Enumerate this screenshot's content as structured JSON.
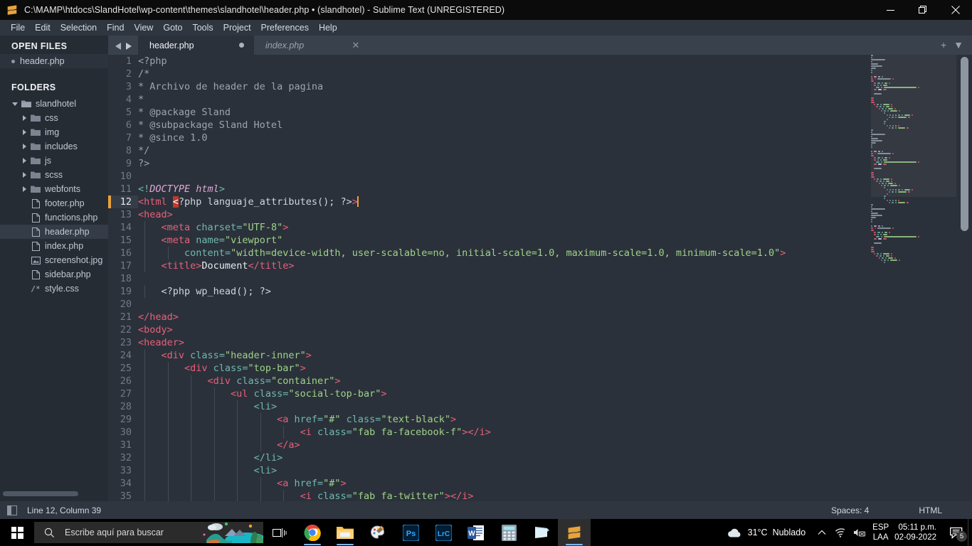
{
  "window": {
    "title": "C:\\MAMP\\htdocs\\SlandHotel\\wp-content\\themes\\slandhotel\\header.php • (slandhotel) - Sublime Text (UNREGISTERED)",
    "app_icon": "sublime-text-icon",
    "controls": {
      "minimize": "minimize-icon",
      "restore": "restore-icon",
      "close": "close-icon"
    }
  },
  "menubar": {
    "items": [
      {
        "label": "File"
      },
      {
        "label": "Edit"
      },
      {
        "label": "Selection"
      },
      {
        "label": "Find"
      },
      {
        "label": "View"
      },
      {
        "label": "Goto"
      },
      {
        "label": "Tools"
      },
      {
        "label": "Project"
      },
      {
        "label": "Preferences"
      },
      {
        "label": "Help"
      }
    ]
  },
  "sidebar": {
    "open_files_header": "OPEN FILES",
    "open_files": [
      {
        "label": "header.php",
        "modified": true
      }
    ],
    "folders_header": "FOLDERS",
    "tree": [
      {
        "label": "slandhotel",
        "kind": "folder-open",
        "depth": 0,
        "expanded": true,
        "selected": false
      },
      {
        "label": "css",
        "kind": "folder",
        "depth": 1,
        "expanded": false,
        "selected": false
      },
      {
        "label": "img",
        "kind": "folder",
        "depth": 1,
        "expanded": false,
        "selected": false
      },
      {
        "label": "includes",
        "kind": "folder",
        "depth": 1,
        "expanded": false,
        "selected": false
      },
      {
        "label": "js",
        "kind": "folder",
        "depth": 1,
        "expanded": false,
        "selected": false
      },
      {
        "label": "scss",
        "kind": "folder",
        "depth": 1,
        "expanded": false,
        "selected": false
      },
      {
        "label": "webfonts",
        "kind": "folder",
        "depth": 1,
        "expanded": false,
        "selected": false
      },
      {
        "label": "footer.php",
        "kind": "file",
        "depth": 1,
        "selected": false
      },
      {
        "label": "functions.php",
        "kind": "file",
        "depth": 1,
        "selected": false
      },
      {
        "label": "header.php",
        "kind": "file",
        "depth": 1,
        "selected": true
      },
      {
        "label": "index.php",
        "kind": "file",
        "depth": 1,
        "selected": false
      },
      {
        "label": "screenshot.jpg",
        "kind": "image",
        "depth": 1,
        "selected": false
      },
      {
        "label": "sidebar.php",
        "kind": "file",
        "depth": 1,
        "selected": false
      },
      {
        "label": "style.css",
        "kind": "css",
        "depth": 1,
        "selected": false
      }
    ]
  },
  "tabs": {
    "nav_prev": "chevron-left-icon",
    "nav_next": "chevron-right-icon",
    "items": [
      {
        "label": "header.php",
        "active": true,
        "modified": true,
        "preview": false
      },
      {
        "label": "index.php",
        "active": false,
        "modified": false,
        "preview": true
      }
    ],
    "new_tab": "+",
    "tab_menu": "▼"
  },
  "editor": {
    "first_line": 1,
    "cursor_line": 12,
    "lines": [
      {
        "n": 1,
        "tokens": [
          {
            "t": "<?php",
            "c": "c-comment"
          }
        ]
      },
      {
        "n": 2,
        "tokens": [
          {
            "t": "/*",
            "c": "c-comment"
          }
        ]
      },
      {
        "n": 3,
        "tokens": [
          {
            "t": "* Archivo de header de la pagina",
            "c": "c-comment"
          }
        ]
      },
      {
        "n": 4,
        "tokens": [
          {
            "t": "*",
            "c": "c-comment"
          }
        ]
      },
      {
        "n": 5,
        "tokens": [
          {
            "t": "* @package Sland",
            "c": "c-comment"
          }
        ]
      },
      {
        "n": 6,
        "tokens": [
          {
            "t": "* @subpackage Sland Hotel",
            "c": "c-comment"
          }
        ]
      },
      {
        "n": 7,
        "tokens": [
          {
            "t": "* @since 1.0",
            "c": "c-comment"
          }
        ]
      },
      {
        "n": 8,
        "tokens": [
          {
            "t": "*/",
            "c": "c-comment"
          }
        ]
      },
      {
        "n": 9,
        "tokens": [
          {
            "t": "?>",
            "c": "c-comment"
          }
        ]
      },
      {
        "n": 10,
        "tokens": []
      },
      {
        "n": 11,
        "tokens": [
          {
            "t": "<!",
            "c": "c-punct"
          },
          {
            "t": "DOCTYPE",
            "c": "c-doctype-name"
          },
          {
            "t": " html",
            "c": "c-doctype-name"
          },
          {
            "t": ">",
            "c": "c-punct"
          }
        ]
      },
      {
        "n": 12,
        "tokens": [
          {
            "t": "<html",
            "c": "c-tag"
          },
          {
            "t": " ",
            "c": "c-php"
          },
          {
            "t": "<",
            "c": "c-err"
          },
          {
            "t": "?php languaje_attributes(); ?>",
            "c": "c-php"
          },
          {
            "t": ">",
            "c": "c-tag"
          },
          {
            "t": "",
            "c": "caret"
          }
        ]
      },
      {
        "n": 13,
        "tokens": [
          {
            "t": "<head>",
            "c": "c-tag"
          }
        ]
      },
      {
        "n": 14,
        "tokens": [
          {
            "t": "    ",
            "c": "c-php"
          },
          {
            "t": "<meta",
            "c": "c-tag"
          },
          {
            "t": " charset",
            "c": "c-punct"
          },
          {
            "t": "=",
            "c": "c-punct"
          },
          {
            "t": "\"UTF-8\"",
            "c": "c-str"
          },
          {
            "t": ">",
            "c": "c-tag"
          }
        ]
      },
      {
        "n": 15,
        "tokens": [
          {
            "t": "    ",
            "c": "c-php"
          },
          {
            "t": "<meta",
            "c": "c-tag"
          },
          {
            "t": " name",
            "c": "c-punct"
          },
          {
            "t": "=",
            "c": "c-punct"
          },
          {
            "t": "\"viewport\"",
            "c": "c-str"
          }
        ]
      },
      {
        "n": 16,
        "tokens": [
          {
            "t": "        ",
            "c": "c-php"
          },
          {
            "t": "content",
            "c": "c-punct"
          },
          {
            "t": "=",
            "c": "c-punct"
          },
          {
            "t": "\"width=device-width, user-scalable=no, initial-scale=1.0, maximum-scale=1.0, minimum-scale=1.0\"",
            "c": "c-str"
          },
          {
            "t": ">",
            "c": "c-tag"
          }
        ]
      },
      {
        "n": 17,
        "tokens": [
          {
            "t": "    ",
            "c": "c-php"
          },
          {
            "t": "<title>",
            "c": "c-tag"
          },
          {
            "t": "Document",
            "c": "c-text"
          },
          {
            "t": "</title>",
            "c": "c-tag"
          }
        ]
      },
      {
        "n": 18,
        "tokens": []
      },
      {
        "n": 19,
        "tokens": [
          {
            "t": "    <?php wp_head(); ?>",
            "c": "c-php"
          }
        ]
      },
      {
        "n": 20,
        "tokens": []
      },
      {
        "n": 21,
        "tokens": [
          {
            "t": "</head>",
            "c": "c-tag"
          }
        ]
      },
      {
        "n": 22,
        "tokens": [
          {
            "t": "<body>",
            "c": "c-tag"
          }
        ]
      },
      {
        "n": 23,
        "tokens": [
          {
            "t": "<header>",
            "c": "c-tag"
          }
        ]
      },
      {
        "n": 24,
        "tokens": [
          {
            "t": "    ",
            "c": "c-php"
          },
          {
            "t": "<div",
            "c": "c-tag"
          },
          {
            "t": " class",
            "c": "c-punct"
          },
          {
            "t": "=",
            "c": "c-punct"
          },
          {
            "t": "\"header-inner\"",
            "c": "c-str"
          },
          {
            "t": ">",
            "c": "c-tag"
          }
        ]
      },
      {
        "n": 25,
        "tokens": [
          {
            "t": "        ",
            "c": "c-php"
          },
          {
            "t": "<div",
            "c": "c-tag"
          },
          {
            "t": " class",
            "c": "c-punct"
          },
          {
            "t": "=",
            "c": "c-punct"
          },
          {
            "t": "\"top-bar\"",
            "c": "c-str"
          },
          {
            "t": ">",
            "c": "c-tag"
          }
        ]
      },
      {
        "n": 26,
        "tokens": [
          {
            "t": "            ",
            "c": "c-php"
          },
          {
            "t": "<div",
            "c": "c-tag"
          },
          {
            "t": " class",
            "c": "c-punct"
          },
          {
            "t": "=",
            "c": "c-punct"
          },
          {
            "t": "\"container\"",
            "c": "c-str"
          },
          {
            "t": ">",
            "c": "c-tag"
          }
        ]
      },
      {
        "n": 27,
        "tokens": [
          {
            "t": "                ",
            "c": "c-php"
          },
          {
            "t": "<ul",
            "c": "c-tag"
          },
          {
            "t": " class",
            "c": "c-punct"
          },
          {
            "t": "=",
            "c": "c-punct"
          },
          {
            "t": "\"social-top-bar\"",
            "c": "c-str"
          },
          {
            "t": ">",
            "c": "c-tag"
          }
        ]
      },
      {
        "n": 28,
        "tokens": [
          {
            "t": "                    ",
            "c": "c-php"
          },
          {
            "t": "<li>",
            "c": "c-punct"
          }
        ]
      },
      {
        "n": 29,
        "tokens": [
          {
            "t": "                        ",
            "c": "c-php"
          },
          {
            "t": "<a",
            "c": "c-entity"
          },
          {
            "t": " href",
            "c": "c-punct"
          },
          {
            "t": "=",
            "c": "c-punct"
          },
          {
            "t": "\"#\"",
            "c": "c-str"
          },
          {
            "t": " class",
            "c": "c-punct"
          },
          {
            "t": "=",
            "c": "c-punct"
          },
          {
            "t": "\"text-black\"",
            "c": "c-str"
          },
          {
            "t": ">",
            "c": "c-tag"
          }
        ]
      },
      {
        "n": 30,
        "tokens": [
          {
            "t": "                            ",
            "c": "c-php"
          },
          {
            "t": "<i",
            "c": "c-entity"
          },
          {
            "t": " class",
            "c": "c-punct"
          },
          {
            "t": "=",
            "c": "c-punct"
          },
          {
            "t": "\"fab fa-facebook-f\"",
            "c": "c-str"
          },
          {
            "t": "></i>",
            "c": "c-entity"
          }
        ]
      },
      {
        "n": 31,
        "tokens": [
          {
            "t": "                        ",
            "c": "c-php"
          },
          {
            "t": "</a>",
            "c": "c-entity"
          }
        ]
      },
      {
        "n": 32,
        "tokens": [
          {
            "t": "                    ",
            "c": "c-php"
          },
          {
            "t": "</li>",
            "c": "c-punct"
          }
        ]
      },
      {
        "n": 33,
        "tokens": [
          {
            "t": "                    ",
            "c": "c-php"
          },
          {
            "t": "<li>",
            "c": "c-punct"
          }
        ]
      },
      {
        "n": 34,
        "tokens": [
          {
            "t": "                        ",
            "c": "c-php"
          },
          {
            "t": "<a",
            "c": "c-entity"
          },
          {
            "t": " href",
            "c": "c-punct"
          },
          {
            "t": "=",
            "c": "c-punct"
          },
          {
            "t": "\"#\"",
            "c": "c-str"
          },
          {
            "t": ">",
            "c": "c-tag"
          }
        ]
      },
      {
        "n": 35,
        "tokens": [
          {
            "t": "                            ",
            "c": "c-php"
          },
          {
            "t": "<i",
            "c": "c-entity"
          },
          {
            "t": " class",
            "c": "c-punct"
          },
          {
            "t": "=",
            "c": "c-punct"
          },
          {
            "t": "\"fab fa-twitter\"",
            "c": "c-str"
          },
          {
            "t": "></i>",
            "c": "c-entity"
          }
        ]
      }
    ]
  },
  "statusbar": {
    "sidebar_toggle": "sidebar-toggle-icon",
    "position": "Line 12, Column 39",
    "indentation": "Spaces: 4",
    "syntax": "HTML"
  },
  "taskbar": {
    "start": "windows-start-icon",
    "search_placeholder": "Escribe aquí para buscar",
    "search_icon": "search-icon",
    "task_view": "task-view-icon",
    "apps": [
      {
        "name": "chrome",
        "active": false,
        "running": true
      },
      {
        "name": "file-explorer",
        "active": false,
        "running": true
      },
      {
        "name": "paint",
        "active": false,
        "running": false
      },
      {
        "name": "photoshop",
        "active": false,
        "running": false
      },
      {
        "name": "lightroom",
        "active": false,
        "running": false
      },
      {
        "name": "word",
        "active": false,
        "running": false
      },
      {
        "name": "calculator",
        "active": false,
        "running": false
      },
      {
        "name": "sticky-notes",
        "active": false,
        "running": false
      },
      {
        "name": "sublime-text",
        "active": true,
        "running": true
      }
    ],
    "tray": {
      "weather_temp": "31°C",
      "weather_desc": "Nublado",
      "weather_icon": "cloud-icon",
      "overflow_icon": "chevron-up-icon",
      "network_icon": "wifi-icon",
      "volume_icon": "volume-muted-icon",
      "lang_line1": "ESP",
      "lang_line2": "LAA",
      "time": "05:11 p.m.",
      "date": "02-09-2022",
      "notifications_icon": "notification-icon",
      "notifications_count": "5"
    }
  },
  "colors": {
    "editor_bg": "#2b313a",
    "sidebar_bg": "#262c34",
    "chrome_bg": "#2f3640",
    "accent_cursor": "#e8a33d",
    "error_bg": "#c0392b",
    "tag": "#e7607b",
    "string": "#9fd38a",
    "comment": "#9aa5b1"
  }
}
